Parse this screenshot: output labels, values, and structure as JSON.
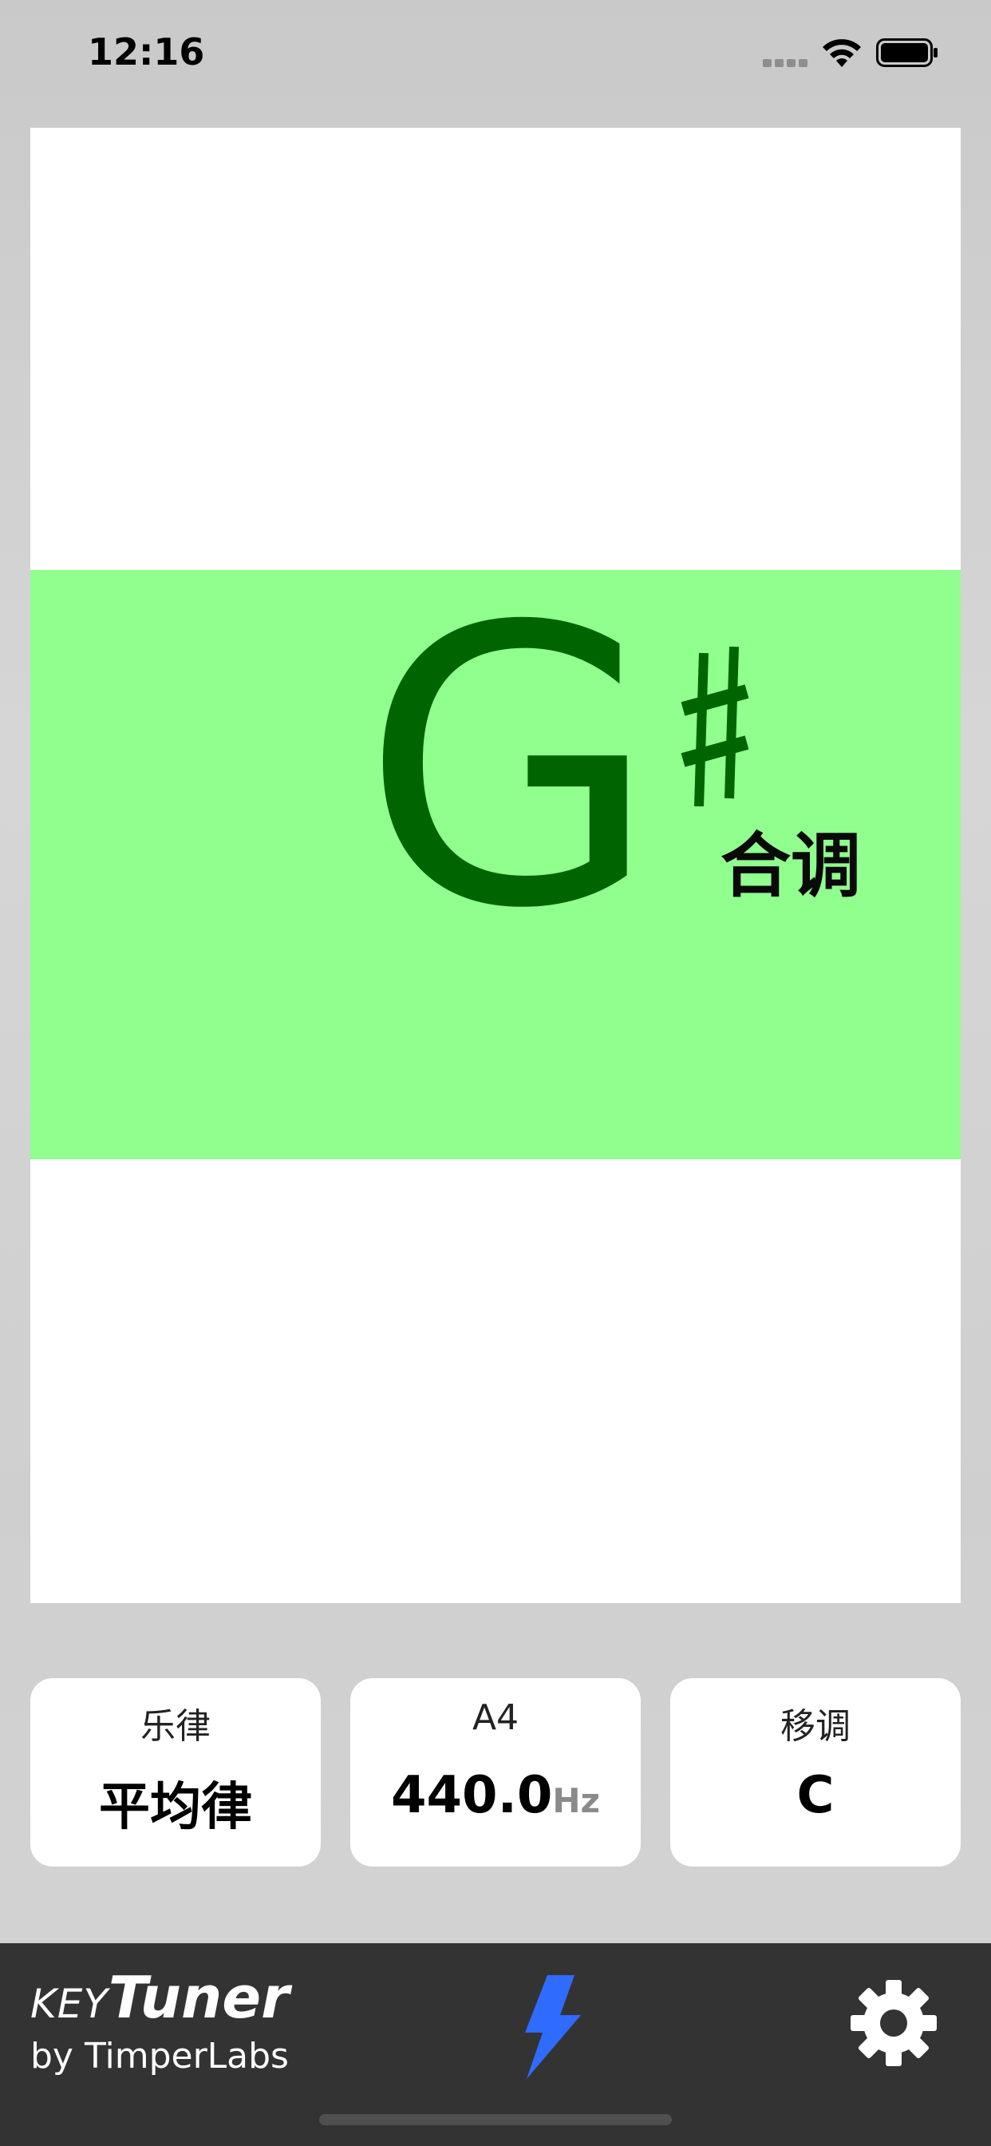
{
  "status_bar": {
    "time": "12:16",
    "icons": [
      "cellular-signal-icon",
      "wifi-icon",
      "battery-icon"
    ]
  },
  "tuner": {
    "note": "G",
    "accidental": "♯",
    "key_suffix": "合调",
    "colors": {
      "band": "#90ff8e",
      "note": "#006400",
      "card": "#ffffff"
    }
  },
  "settings": {
    "temperament": {
      "label": "乐律",
      "value": "平均律"
    },
    "pitch": {
      "label": "A4",
      "value": "440.0",
      "unit": "Hz"
    },
    "transpose": {
      "label": "移调",
      "value": "C"
    }
  },
  "bottom_bar": {
    "logo_key": "KEY",
    "logo_tuner": "Tuner",
    "byline": "by TimperLabs",
    "bolt_icon": "lightning-bolt-icon",
    "settings_icon": "gear-icon",
    "colors": {
      "background": "#333333",
      "bolt": "#2f6bff",
      "gear": "#ffffff"
    }
  }
}
